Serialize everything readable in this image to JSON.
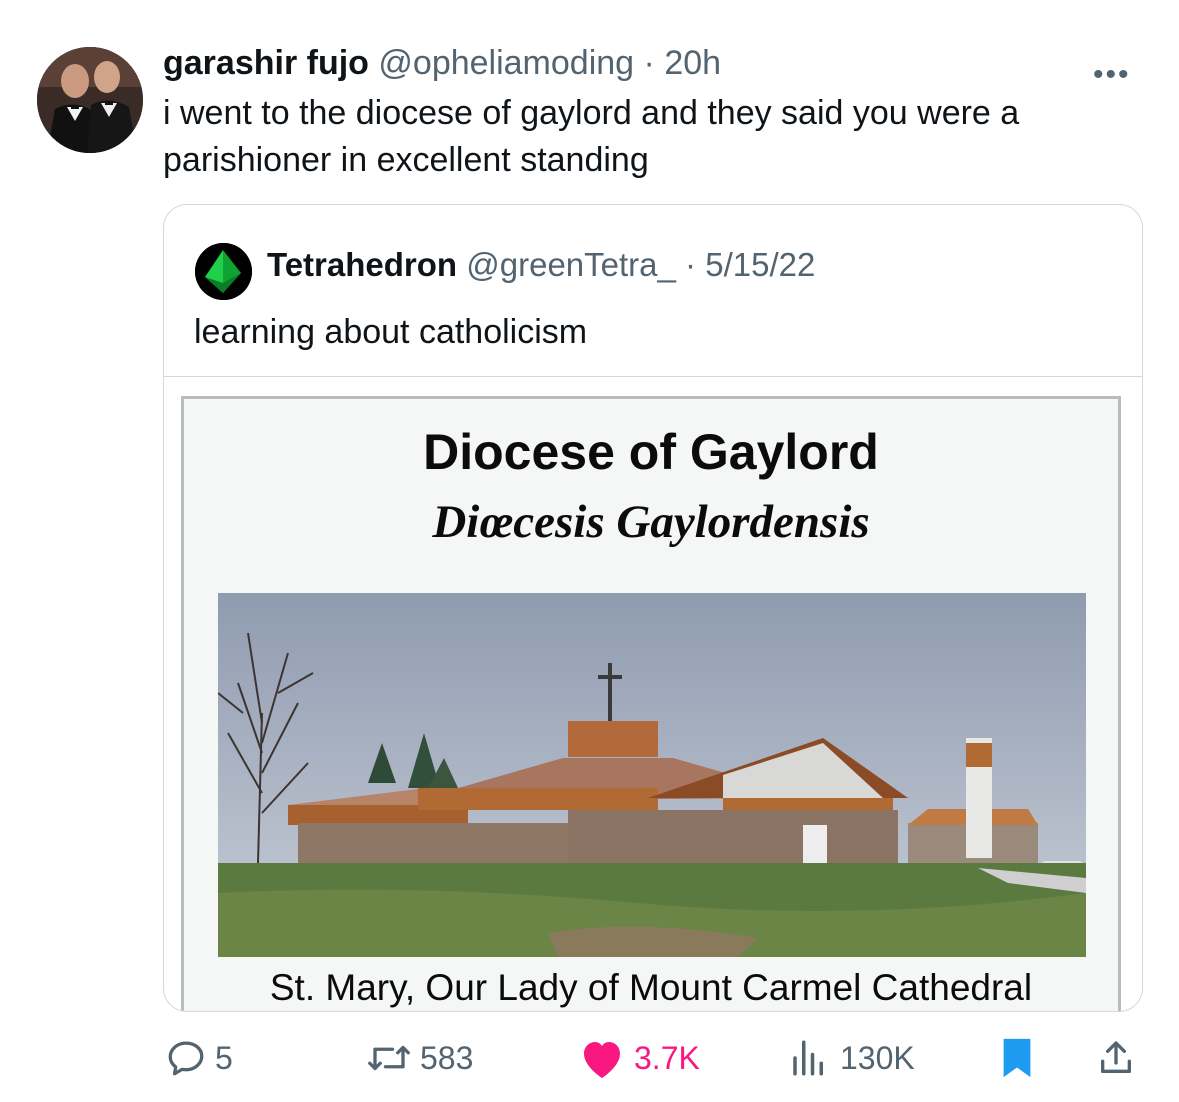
{
  "tweet": {
    "author_name": "garashir fujo",
    "author_handle": "@opheliamoding",
    "separator": "·",
    "time": "20h",
    "more_label": "•••",
    "text": "i went to the diocese of gaylord and they said you were a parishioner in excellent standing"
  },
  "quoted": {
    "author_name": "Tetrahedron",
    "author_handle": "@greenTetra_",
    "separator": "·",
    "date": "5/15/22",
    "text": "learning about catholicism",
    "image": {
      "title": "Diocese of Gaylord",
      "subtitle": "Diœcesis Gaylordensis",
      "caption": "St. Mary, Our Lady of Mount Carmel Cathedral"
    }
  },
  "actions": {
    "replies": "5",
    "retweets": "583",
    "likes": "3.7K",
    "views": "130K"
  },
  "colors": {
    "text": "#0f1419",
    "muted": "#536471",
    "like": "#f91880",
    "bookmark": "#1d9bf0",
    "border": "#cfd9de"
  }
}
